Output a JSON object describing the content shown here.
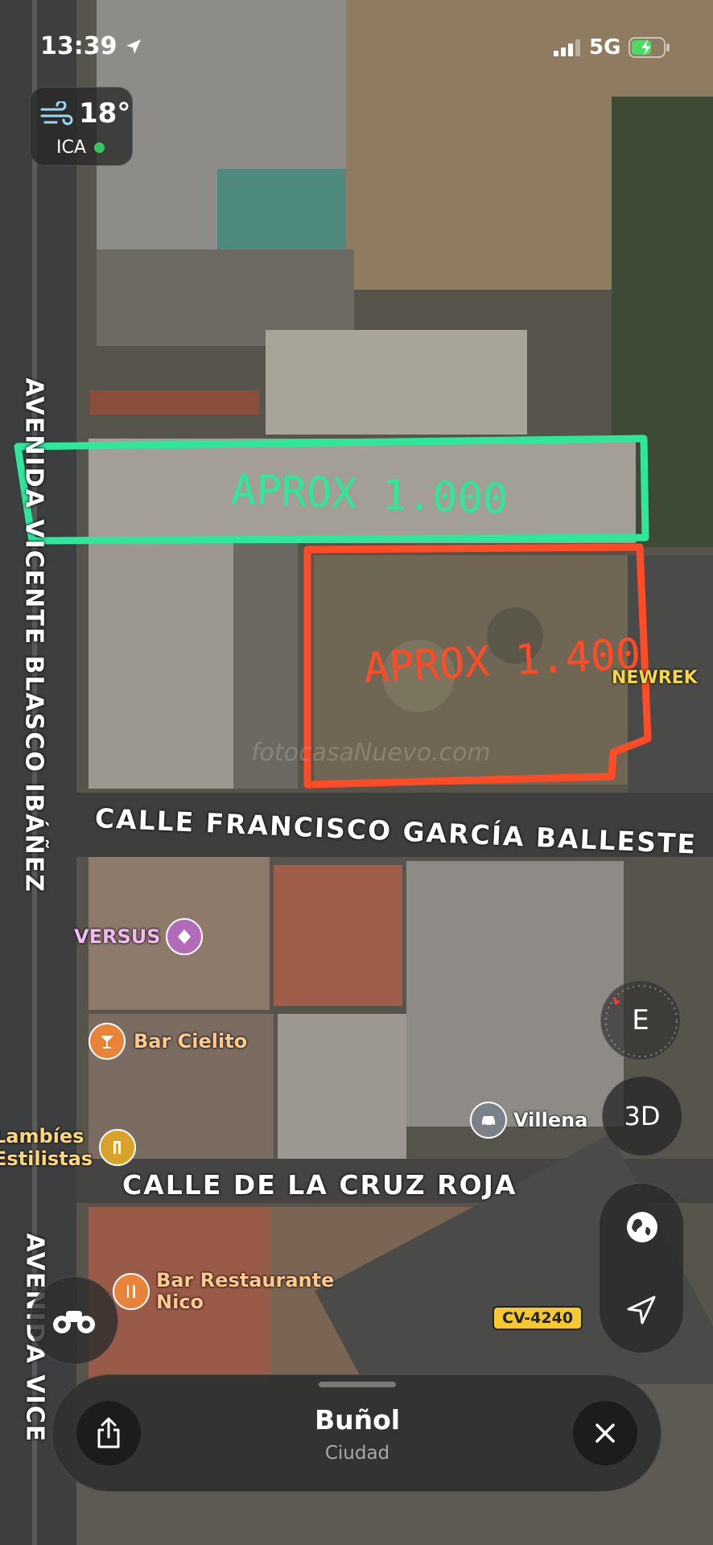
{
  "status_bar": {
    "time": "13:39",
    "network": "5G"
  },
  "weather": {
    "temperature": "18°",
    "air_quality": "ICA",
    "aqi_color": "#34c759"
  },
  "annotations": {
    "green_box_text": "APROX 1.000",
    "green_color": "#2ee89a",
    "red_box_text": "APROX 1.400",
    "red_color": "#ff4b26"
  },
  "watermark": "fotocasaNuevo.com",
  "streets": {
    "avenida_top": "AVENIDA VICENTE BLASCO IBÁÑEZ",
    "francisco": "CALLE FRANCISCO GARCÍA BALLESTE",
    "cruz_roja": "CALLE DE LA CRUZ ROJA",
    "avenida_bottom": "AVENIDA VICE"
  },
  "pois": [
    {
      "id": "newrek",
      "label": "NEWREK",
      "icon": "none"
    },
    {
      "id": "versus",
      "label": "VERSUS",
      "icon": "nightclub-icon",
      "color": "#b36ab8"
    },
    {
      "id": "bar-cielito",
      "label": "Bar Cielito",
      "icon": "cocktail-icon",
      "color": "#e8833a"
    },
    {
      "id": "lambies",
      "label_line1": "Lambíes",
      "label_line2": "Estilistas",
      "icon": "hair-salon-icon",
      "color": "#d9a22b"
    },
    {
      "id": "villena",
      "label": "Villena",
      "icon": "car-service-icon",
      "color": "#7c8088"
    },
    {
      "id": "bar-nico",
      "label_line1": "Bar Restaurante",
      "label_line2": "Nico",
      "icon": "restaurant-icon",
      "color": "#e8833a"
    }
  ],
  "road_shield": "CV-4240",
  "controls": {
    "compass_label": "E",
    "three_d_label": "3D"
  },
  "place_card": {
    "title": "Buñol",
    "subtitle": "Ciudad"
  }
}
